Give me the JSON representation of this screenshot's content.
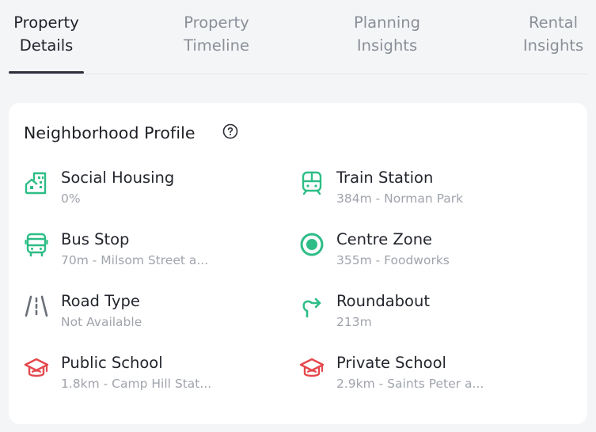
{
  "tabs": [
    {
      "label": "Property Details"
    },
    {
      "label": "Property Timeline"
    },
    {
      "label": "Planning Insights"
    },
    {
      "label": "Rental Insights"
    }
  ],
  "card": {
    "title": "Neighborhood Profile",
    "items": [
      {
        "label": "Social Housing",
        "value": "0%",
        "icon": "building-icon"
      },
      {
        "label": "Train Station",
        "value": "384m - Norman Park",
        "icon": "train-icon"
      },
      {
        "label": "Bus Stop",
        "value": "70m - Milsom Street a...",
        "icon": "bus-icon"
      },
      {
        "label": "Centre Zone",
        "value": "355m - Foodworks",
        "icon": "target-icon"
      },
      {
        "label": "Road Type",
        "value": "Not Available",
        "icon": "road-icon"
      },
      {
        "label": "Roundabout",
        "value": "213m",
        "icon": "roundabout-icon"
      },
      {
        "label": "Public School",
        "value": "1.8km - Camp Hill Stat...",
        "icon": "graduation-cap-icon"
      },
      {
        "label": "Private School",
        "value": "2.9km - Saints Peter a...",
        "icon": "graduation-cap-icon"
      }
    ]
  },
  "colors": {
    "accent_green": "#2dbd86",
    "school_red": "#e5484d",
    "road_gray": "#6b6f78"
  }
}
